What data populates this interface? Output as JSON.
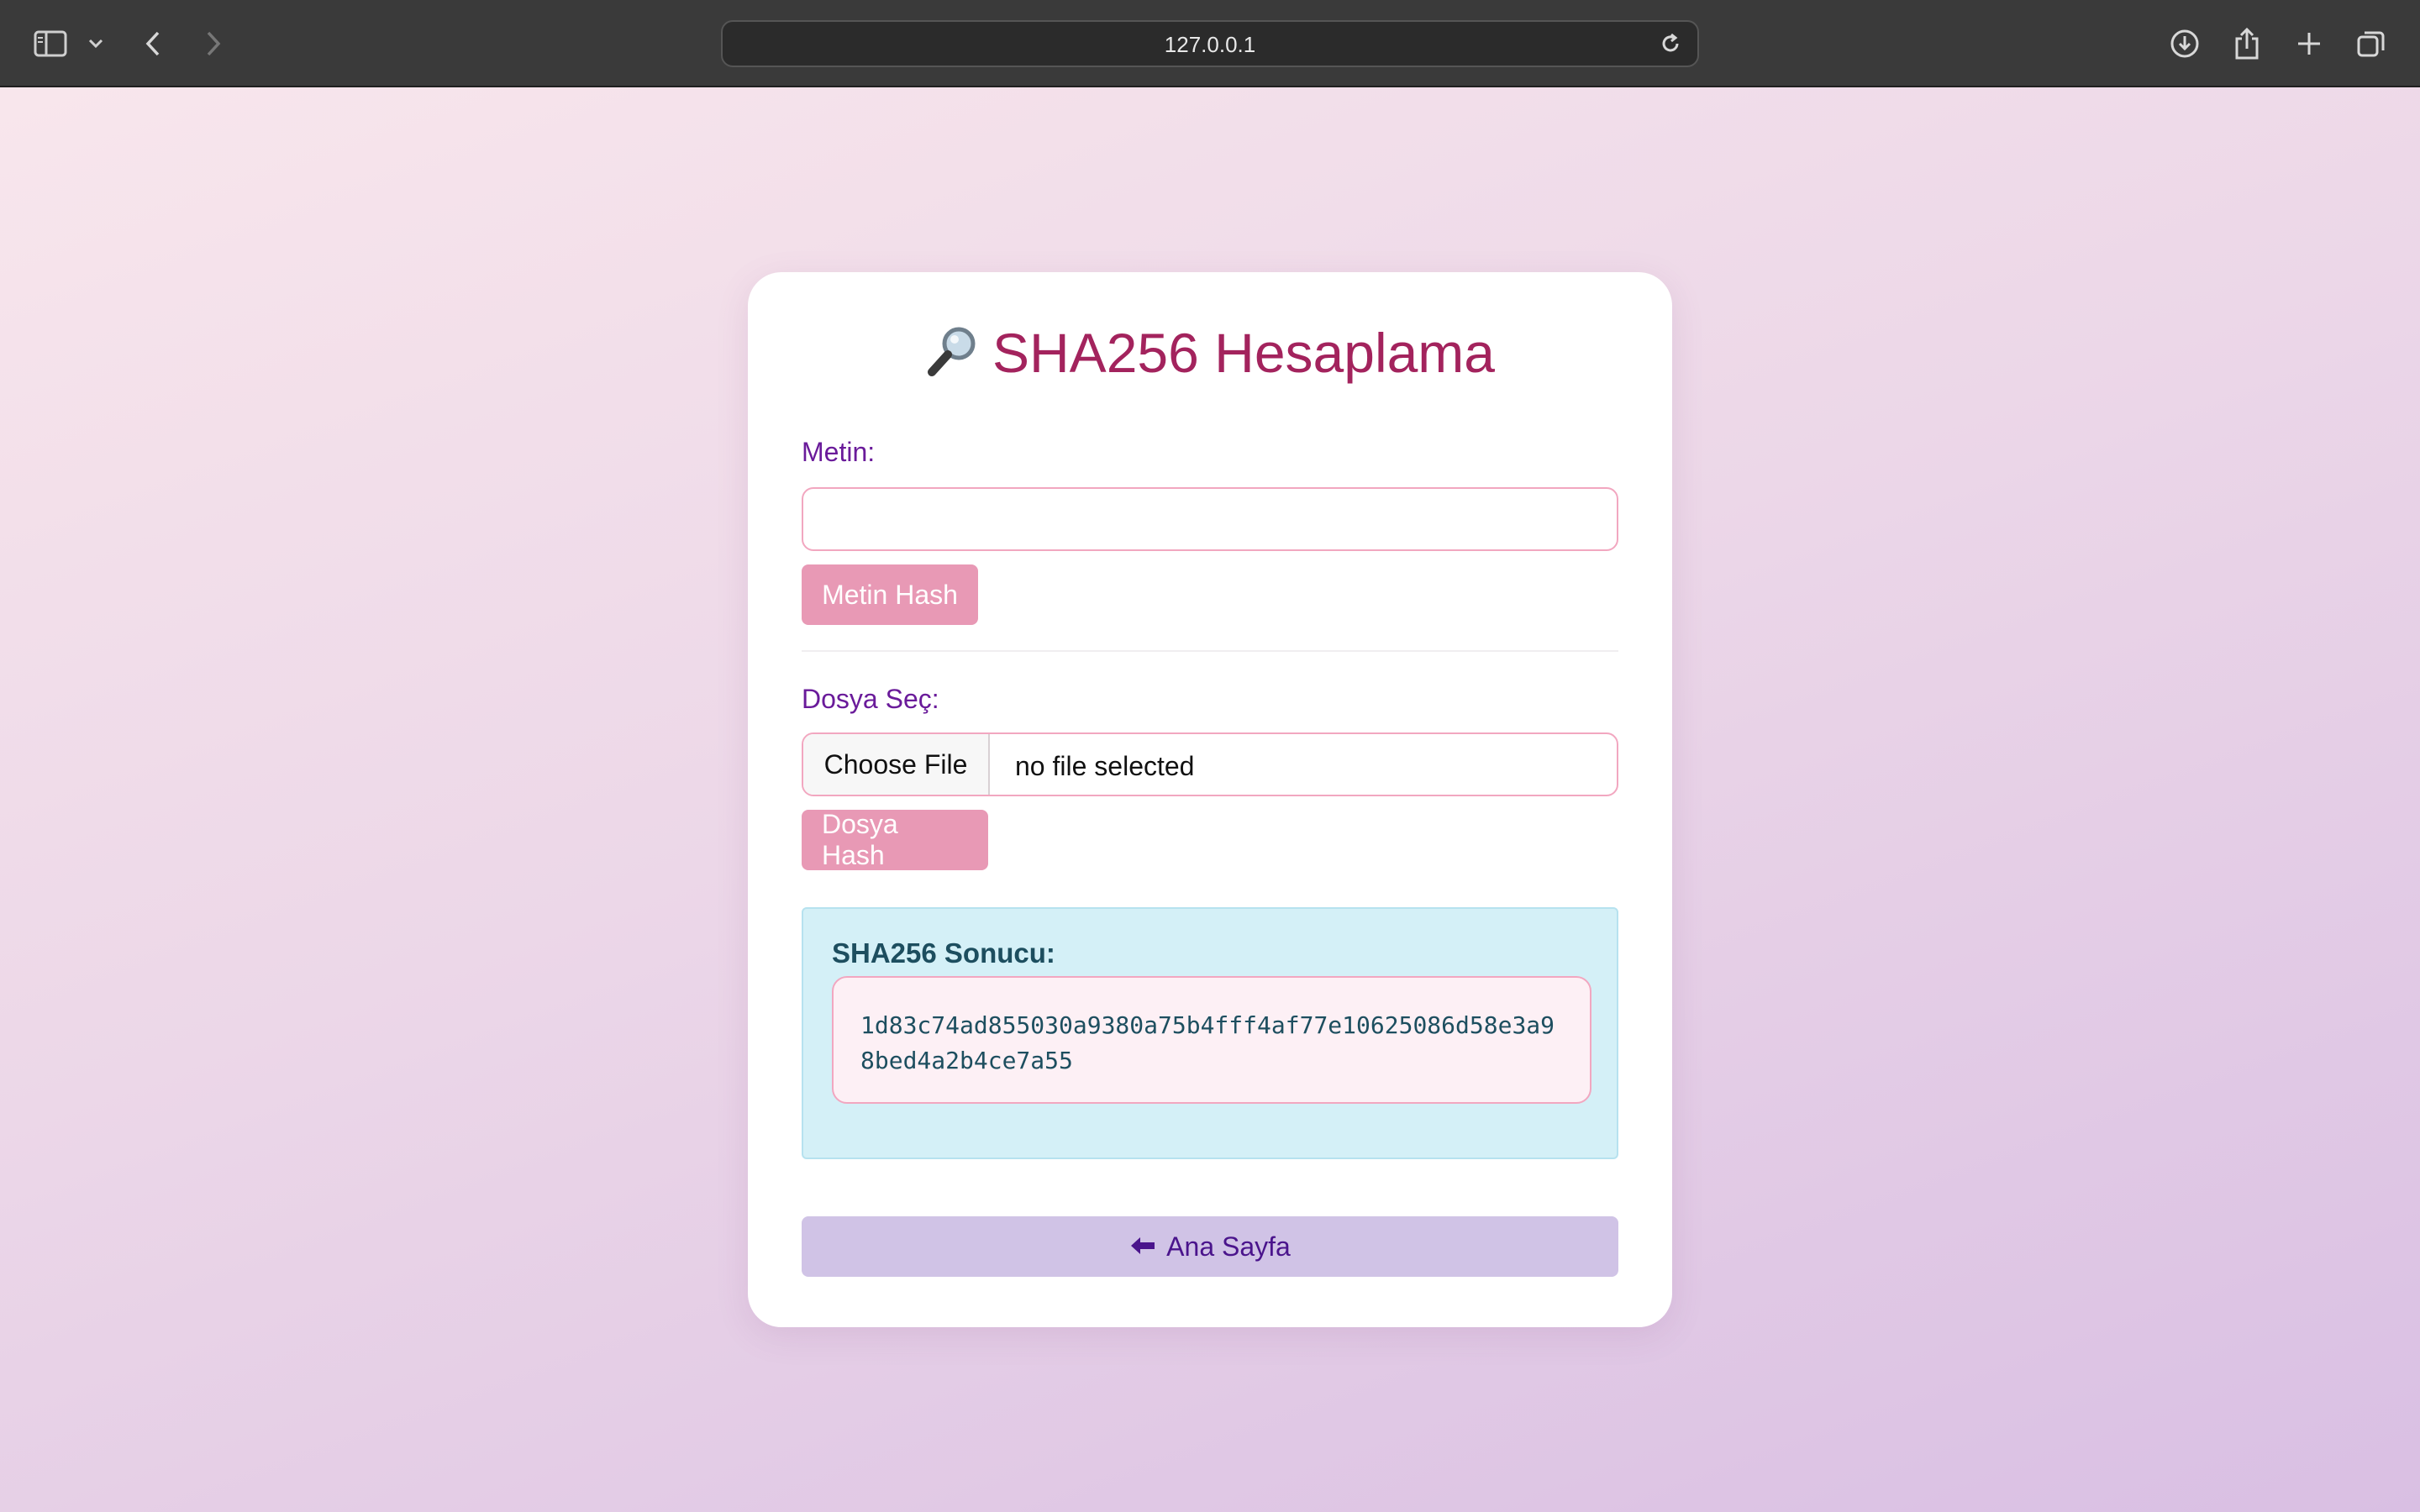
{
  "browser": {
    "url": "127.0.0.1"
  },
  "page": {
    "title": "SHA256 Hesaplama",
    "text_section": {
      "label": "Metin:",
      "input_value": "",
      "button_label": "Metin Hash"
    },
    "file_section": {
      "label": "Dosya Seç:",
      "choose_button": "Choose File",
      "file_status": "no file selected",
      "button_label": "Dosya Hash"
    },
    "result": {
      "title": "SHA256 Sonucu:",
      "hash": "1d83c74ad855030a9380a75b4fff4af77e10625086d58e3a98bed4a2b4ce7a55"
    },
    "home_button": "Ana Sayfa"
  },
  "colors": {
    "title": "#a3235d",
    "label": "#6a1b9a",
    "pink_button": "#e899b5",
    "result_bg": "#d4f0f7",
    "home_button_bg": "#d0c3e6"
  }
}
